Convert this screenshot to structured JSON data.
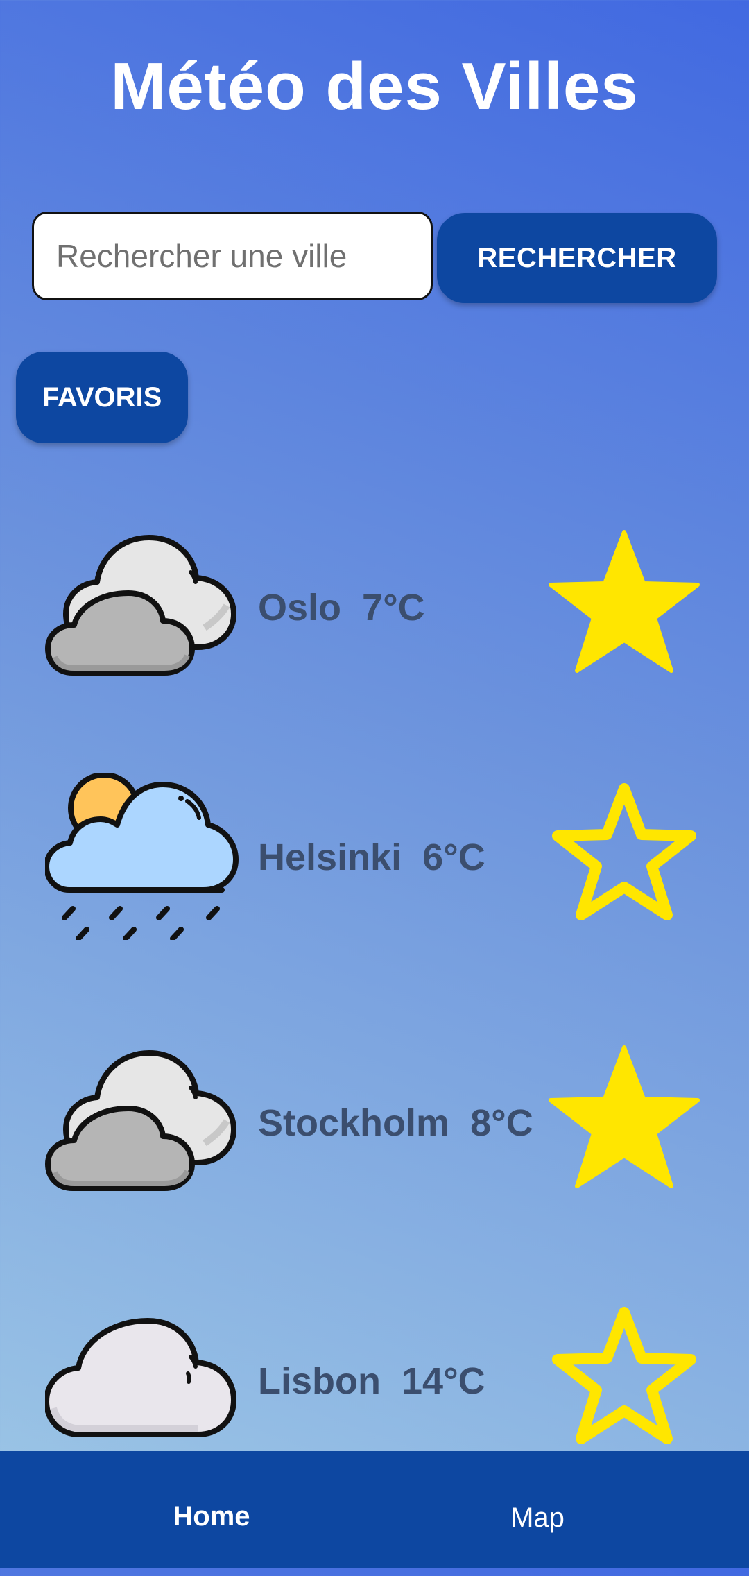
{
  "header": {
    "title": "Météo des Villes"
  },
  "search": {
    "placeholder": "Rechercher une ville",
    "value": "",
    "button_label": "RECHERCHER"
  },
  "favorites_button": {
    "label": "FAVORIS"
  },
  "cities": [
    {
      "name": "Oslo",
      "temperature": "7°C",
      "weather_icon": "cloudy-icon",
      "favorite": true
    },
    {
      "name": "Helsinki",
      "temperature": "6°C",
      "weather_icon": "partly-cloudy-rain-icon",
      "favorite": false
    },
    {
      "name": "Stockholm",
      "temperature": "8°C",
      "weather_icon": "cloudy-icon",
      "favorite": true
    },
    {
      "name": "Lisbon",
      "temperature": "14°C",
      "weather_icon": "cloud-icon",
      "favorite": false
    }
  ],
  "bottom_nav": {
    "items": [
      {
        "label": "Home",
        "active": true
      },
      {
        "label": "Map",
        "active": false
      }
    ]
  },
  "colors": {
    "primary": "#0d47a1",
    "star": "#ffe600",
    "city_text": "#3b4e6e",
    "gradient_top": "#4169e1",
    "gradient_bottom": "#9fc9e6"
  }
}
